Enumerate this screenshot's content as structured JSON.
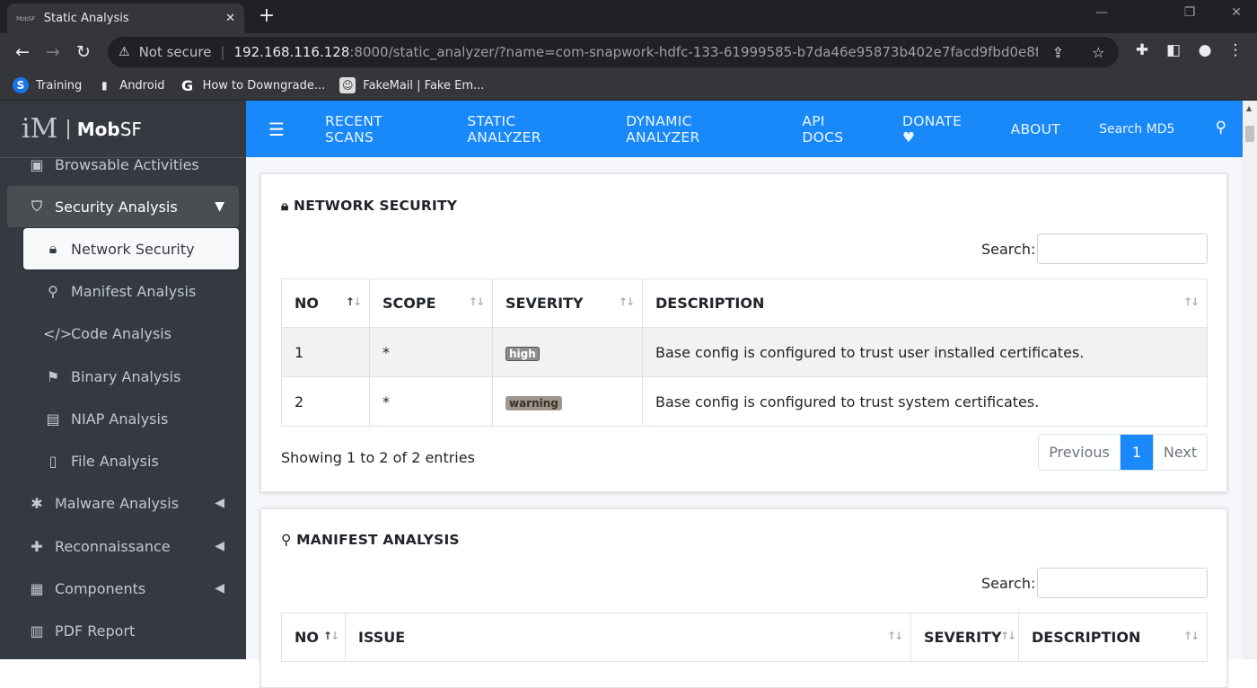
{
  "browser": {
    "tab_favicon": "MobSF",
    "tab_title": "Static Analysis",
    "tab_close": "✕",
    "new_tab": "+",
    "security_label": "Not secure",
    "url_host": "192.168.116.128",
    "url_rest": ":8000/static_analyzer/?name=com-snapwork-hdfc-133-61999585-b7da46e95873b402e7facd9fbd0e8f1e.apk&checksu...",
    "bookmarks": [
      {
        "label": "Training",
        "icon": "S"
      },
      {
        "label": "Android",
        "icon": "▮"
      },
      {
        "label": "How to Downgrade...",
        "icon": "G"
      },
      {
        "label": "FakeMail | Fake Em...",
        "icon": "☺"
      }
    ]
  },
  "app": {
    "brand": "MobSF",
    "brand_bold": "Mob",
    "brand_light": "SF",
    "brand_logo": "iM",
    "brand_separator": "|"
  },
  "sidebar": {
    "items": [
      {
        "label": "Browsable Activities",
        "icon": "window-icon"
      },
      {
        "label": "Security Analysis",
        "icon": "shield-icon",
        "open": true
      },
      {
        "label": "Network Security",
        "icon": "lock-icon",
        "active": true
      },
      {
        "label": "Manifest Analysis",
        "icon": "search-icon"
      },
      {
        "label": "Code Analysis",
        "icon": "code-icon"
      },
      {
        "label": "Binary Analysis",
        "icon": "flag-icon"
      },
      {
        "label": "NIAP Analysis",
        "icon": "id-card-icon"
      },
      {
        "label": "File Analysis",
        "icon": "file-icon"
      },
      {
        "label": "Malware Analysis",
        "icon": "bug-icon"
      },
      {
        "label": "Reconnaissance",
        "icon": "plus-icon"
      },
      {
        "label": "Components",
        "icon": "grid-icon"
      },
      {
        "label": "PDF Report",
        "icon": "pdf-icon"
      }
    ]
  },
  "topnav": {
    "links": [
      "RECENT SCANS",
      "STATIC ANALYZER",
      "DYNAMIC ANALYZER",
      "API DOCS",
      "DONATE ♥",
      "ABOUT"
    ],
    "search_placeholder": "Search MD5"
  },
  "network_security": {
    "title": "NETWORK SECURITY",
    "search_label": "Search:",
    "columns": [
      "NO",
      "SCOPE",
      "SEVERITY",
      "DESCRIPTION"
    ],
    "rows": [
      {
        "no": "1",
        "scope": "*",
        "severity": "high",
        "description": "Base config is configured to trust user installed certificates."
      },
      {
        "no": "2",
        "scope": "*",
        "severity": "warning",
        "description": "Base config is configured to trust system certificates."
      }
    ],
    "info": "Showing 1 to 2 of 2 entries",
    "pager": {
      "previous": "Previous",
      "current": "1",
      "next": "Next"
    }
  },
  "manifest_analysis": {
    "title": "MANIFEST ANALYSIS",
    "search_label": "Search:",
    "columns": [
      "NO",
      "ISSUE",
      "SEVERITY",
      "DESCRIPTION"
    ]
  },
  "colors": {
    "topnav": "#1989fa",
    "sidebar": "#343a40",
    "badge_high": "#8c8c8c",
    "badge_warning": "#9e9690"
  }
}
